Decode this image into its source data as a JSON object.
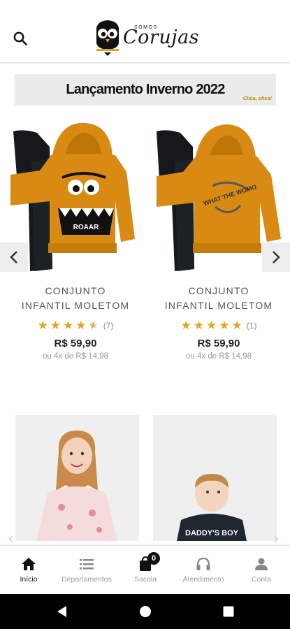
{
  "header": {
    "logo_small": "SOMOS",
    "logo_main": "Corujas",
    "search_icon": "search-icon",
    "logo_icon": "owl-logo-icon"
  },
  "banner": {
    "title": "Lançamento Inverno 2022",
    "cta": "Clica, clica!"
  },
  "products": [
    {
      "name_line1": "CONJUNTO",
      "name_line2": "INFANTIL MOLETOM",
      "rating": 4.5,
      "review_count": "(7)",
      "price": "R$ 59,90",
      "installments": "ou 4x de R$ 14,98",
      "print_text": "ROAAR"
    },
    {
      "name_line1": "CONJUNTO",
      "name_line2": "INFANTIL MOLETOM",
      "rating": 5,
      "review_count": "(1)",
      "price": "R$ 59,90",
      "installments": "ou 4x de R$ 14,98",
      "print_text": "WHAT THE WOMO"
    }
  ],
  "cards": [
    {
      "print_text": ""
    },
    {
      "print_text": "DADDY'S BOY"
    }
  ],
  "bottom_nav": [
    {
      "label": "Início",
      "icon": "home-icon",
      "active": true
    },
    {
      "label": "Departamentos",
      "icon": "list-icon",
      "active": false
    },
    {
      "label": "Sacola",
      "icon": "bag-icon",
      "active": false,
      "badge": "0"
    },
    {
      "label": "Atendimento",
      "icon": "headset-icon",
      "active": false
    },
    {
      "label": "Conta",
      "icon": "user-icon",
      "active": false
    }
  ],
  "colors": {
    "accent": "#e0a814",
    "mustard": "#d98a12",
    "banner_bg": "#ebebeb"
  }
}
